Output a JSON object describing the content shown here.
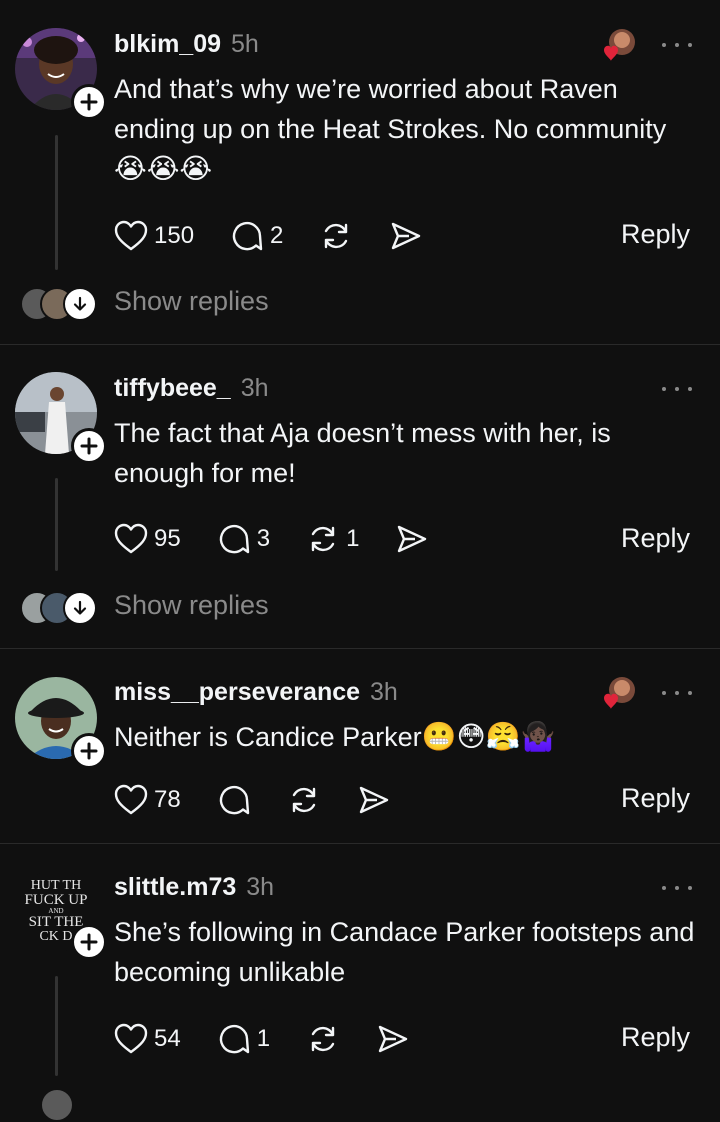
{
  "comments": [
    {
      "username": "blkim_09",
      "time": "5h",
      "text": "And that’s why we’re worried about Raven ending up on the Heat Strokes. No community",
      "emoji": "😭😭😭",
      "likes": "150",
      "replies": "2",
      "reposts": "",
      "reply_label": "Reply",
      "show_replies": "Show replies"
    },
    {
      "username": "tiffybeee_",
      "time": "3h",
      "text": "The fact that Aja doesn’t mess with her, is enough for me!",
      "likes": "95",
      "replies": "3",
      "reposts": "1",
      "reply_label": "Reply",
      "show_replies": "Show replies"
    },
    {
      "username": "miss__perseverance",
      "time": "3h",
      "text": "Neither is Candice Parker",
      "emoji": "😬😳😤🤷🏿‍♀️",
      "likes": "78",
      "replies": "",
      "reposts": "",
      "reply_label": "Reply"
    },
    {
      "username": "slittle.m73",
      "time": "3h",
      "text": "She’s following in Candace Parker footsteps and becoming unlikable",
      "likes": "54",
      "replies": "1",
      "reposts": "",
      "reply_label": "Reply",
      "avatar_text": [
        "HUT TH",
        "FUCK UP",
        "AND",
        "SIT THE",
        "CK D"
      ]
    }
  ],
  "colors": {
    "background": "#101010",
    "text_primary": "#f3f5f7",
    "text_secondary": "#8a8a8a",
    "divider": "#2a2a2a",
    "heart_red": "#e0243a"
  },
  "icons": [
    "heart-icon",
    "comment-icon",
    "repost-icon",
    "share-icon",
    "more-icon",
    "plus-icon",
    "arrow-down-icon"
  ]
}
